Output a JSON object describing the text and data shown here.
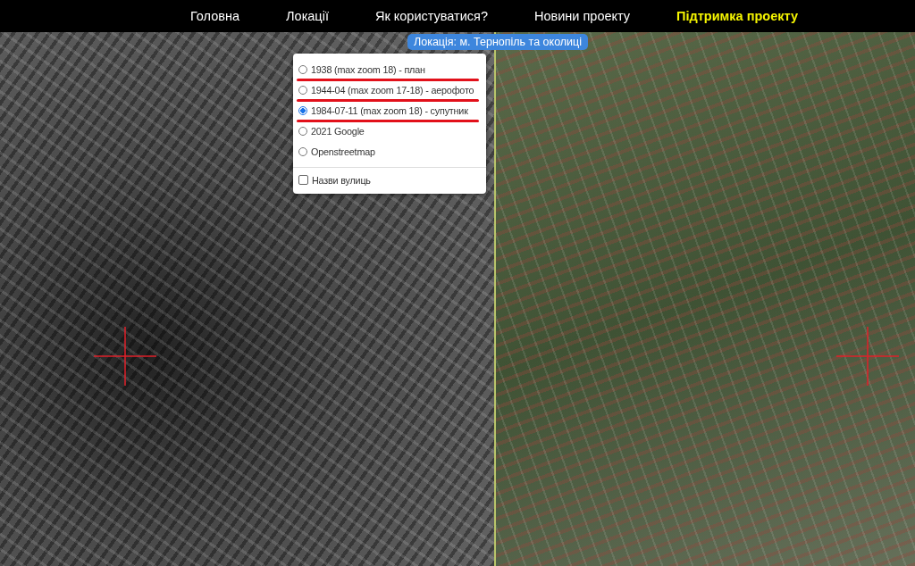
{
  "nav": [
    {
      "label": "Головна",
      "highlighted": false
    },
    {
      "label": "Локації",
      "highlighted": false
    },
    {
      "label": "Як користуватися?",
      "highlighted": false
    },
    {
      "label": "Новини проекту",
      "highlighted": false
    },
    {
      "label": "Підтримка проекту",
      "highlighted": true
    }
  ],
  "location_badge": "Локація: м. Тернопіль та околиці",
  "layers": [
    {
      "label": "1938 (max zoom 18) - план",
      "selected": false,
      "underlined": true
    },
    {
      "label": "1944-04 (max zoom 17-18) - аерофото",
      "selected": false,
      "underlined": true
    },
    {
      "label": "1984-07-11 (max zoom 18) - супутник",
      "selected": true,
      "underlined": true
    },
    {
      "label": "2021 Google",
      "selected": false,
      "underlined": false
    },
    {
      "label": "Openstreetmap",
      "selected": false,
      "underlined": false
    }
  ],
  "overlays": [
    {
      "label": "Назви вулиць",
      "checked": false
    }
  ]
}
